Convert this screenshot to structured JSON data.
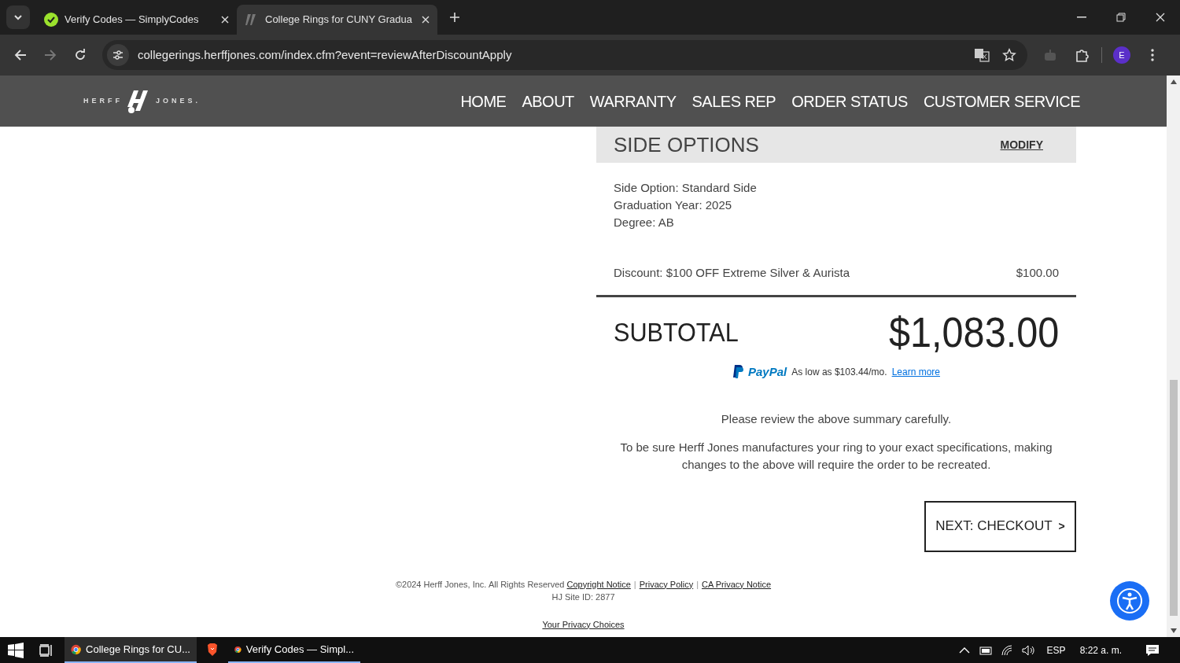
{
  "browser": {
    "tabs": [
      {
        "title": "Verify Codes — SimplyCodes",
        "kind": "simplycodes",
        "selected": false
      },
      {
        "title": "College Rings for CUNY Gradua",
        "kind": "herff",
        "selected": true
      }
    ],
    "url": "collegerings.herffjones.com/index.cfm?event=reviewAfterDiscountApply",
    "profile_initial": "E"
  },
  "site": {
    "logo": {
      "left": "HERFF",
      "right": "JONES."
    },
    "nav": [
      "HOME",
      "ABOUT",
      "WARRANTY",
      "SALES REP",
      "ORDER STATUS",
      "CUSTOMER SERVICE"
    ]
  },
  "section": {
    "title": "SIDE OPTIONS",
    "action": "MODIFY",
    "details": [
      "Side Option: Standard Side",
      "Graduation Year: 2025",
      "Degree: AB"
    ]
  },
  "discount": {
    "label": "Discount: $100 OFF Extreme Silver & Aurista",
    "amount": "$100.00"
  },
  "subtotal": {
    "label": "SUBTOTAL",
    "amount": "$1,083.00"
  },
  "paypal": {
    "brand": "PayPal",
    "text": "As low as $103.44/mo.",
    "link": "Learn more"
  },
  "notes": [
    "Please review the above summary carefully.",
    "To be sure Herff Jones manufactures your ring to your exact specifications, making changes to the above will require the order to be recreated."
  ],
  "checkout_button": {
    "label": "NEXT: CHECKOUT",
    "caret": ">"
  },
  "footer": {
    "copyright": "©2024 Herff Jones, Inc. All Rights Reserved",
    "links": [
      "Copyright Notice",
      "Privacy Policy",
      "CA Privacy Notice"
    ],
    "separator": "|",
    "site_id": "HJ Site ID: 2877",
    "privacy_choices": "Your Privacy Choices"
  },
  "taskbar": {
    "apps": [
      {
        "label": "College Rings for CU...",
        "kind": "chrome",
        "selected": true
      },
      {
        "kind": "brave",
        "selected": false
      },
      {
        "label": "Verify Codes — Simpl...",
        "kind": "chrome",
        "selected": false
      }
    ],
    "language": "ESP",
    "time": "8:22 a. m."
  }
}
